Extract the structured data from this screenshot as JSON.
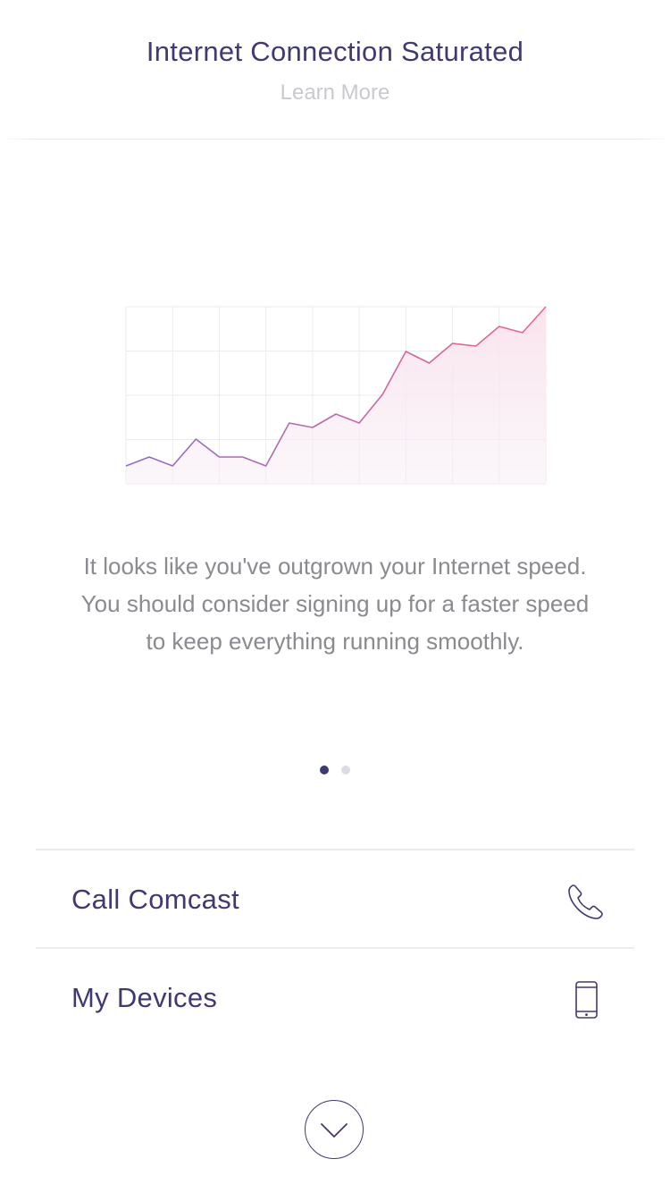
{
  "header": {
    "title": "Internet Connection Saturated",
    "link_label": "Learn More"
  },
  "chart_data": {
    "type": "area",
    "x": [
      0,
      1,
      2,
      3,
      4,
      5,
      6,
      7,
      8,
      9,
      10,
      11,
      12,
      13,
      14,
      15,
      16,
      17,
      18
    ],
    "values": [
      20,
      30,
      20,
      50,
      30,
      30,
      20,
      68,
      63,
      78,
      68,
      100,
      148,
      135,
      157,
      154,
      176,
      169,
      198
    ],
    "ylim": [
      0,
      198
    ],
    "grid": true,
    "colors": {
      "line_start": "#8c6fc6",
      "line_end": "#f0648a",
      "fill_start": "#f7eef6",
      "fill_end": "#fbe3ec",
      "grid": "#ebebf1"
    }
  },
  "message": {
    "text": "It looks like you've outgrown your Internet speed. You should consider signing up for a faster speed to keep everything running smoothly."
  },
  "pager": {
    "active_index": 0,
    "count": 2
  },
  "actions": [
    {
      "label": "Call Comcast",
      "icon": "phone-icon"
    },
    {
      "label": "My Devices",
      "icon": "smartphone-icon"
    }
  ],
  "expand": {
    "icon": "chevron-down-icon"
  },
  "colors": {
    "primary": "#3f3a72",
    "muted_text": "#8a8a90",
    "link_gray": "#c9c9cf",
    "divider": "#ececee"
  }
}
